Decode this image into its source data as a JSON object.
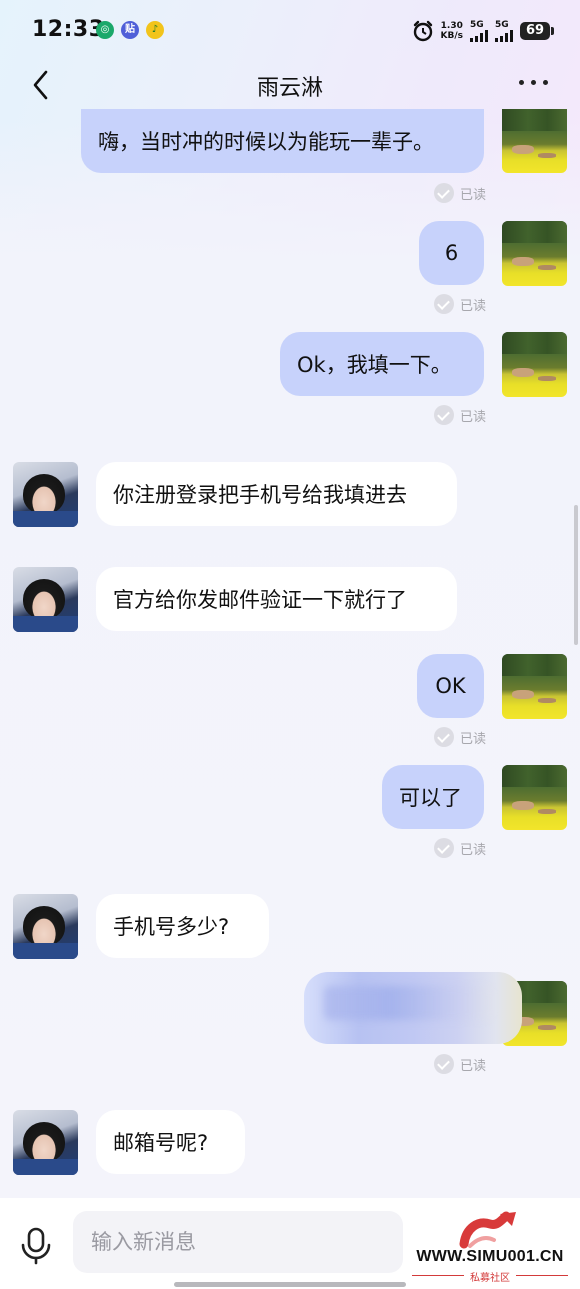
{
  "status_bar": {
    "time": "12:33",
    "app_icons": [
      "china-mobile-icon",
      "tieba-icon",
      "qq-music-icon"
    ],
    "net_speed_value": "1.30",
    "net_speed_unit": "KB/s",
    "sim1_label": "5G",
    "sim2_label": "5G",
    "battery": "69"
  },
  "header": {
    "title": "雨云淋",
    "back_icon": "chevron-left-icon",
    "more_icon": "more-dots-icon"
  },
  "read_label": "已读",
  "messages": [
    {
      "side": "out",
      "text": "嗨，当时冲的时候以为能玩一辈子。",
      "read": true
    },
    {
      "side": "out",
      "text": "6",
      "read": true
    },
    {
      "side": "out",
      "text": "Ok，我填一下。",
      "read": true
    },
    {
      "side": "in",
      "text": "你注册登录把手机号给我填进去"
    },
    {
      "side": "in",
      "text": "官方给你发邮件验证一下就行了"
    },
    {
      "side": "out",
      "text": "OK",
      "read": true
    },
    {
      "side": "out",
      "text": "可以了",
      "read": true
    },
    {
      "side": "in",
      "text": "手机号多少?"
    },
    {
      "side": "out",
      "text": "",
      "blurred": true,
      "read": true
    },
    {
      "side": "in",
      "text": "邮箱号呢?"
    }
  ],
  "input": {
    "placeholder": "输入新消息",
    "voice_icon": "microphone-icon"
  },
  "watermark": {
    "url": "WWW.SIMU001.CN",
    "subtitle": "私募社区"
  },
  "colors": {
    "outgoing_bubble": "#c7d2fb",
    "incoming_bubble": "#ffffff",
    "read_gray": "#a7a7ad",
    "watermark_red": "#d33a3a"
  }
}
